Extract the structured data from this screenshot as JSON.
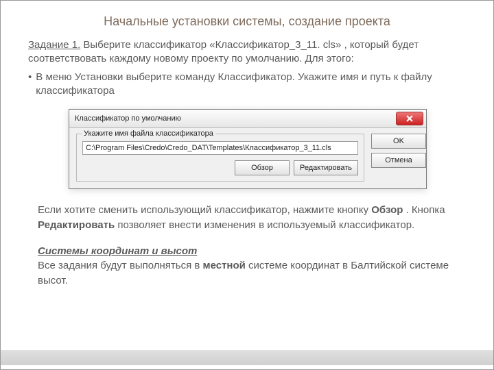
{
  "title": "Начальные установки системы, создание проекта",
  "task_label": "Задание 1.",
  "task_text": " Выберите классификатор «Классификатор_3_11. cls» , который будет соответствовать каждому новому проекту по умолчанию. Для этого:",
  "bullet_text": "В меню Установки выберите команду  Классификатор.   Укажите имя и путь к файлу  классификатора",
  "dialog": {
    "title": "Классификатор по умолчанию",
    "group_label": "Укажите имя файла классификатора",
    "path_value": "C:\\Program Files\\Credo\\Credo_DAT\\Templates\\Классификатор_3_11.cls",
    "browse": "Обзор",
    "edit": "Редактировать",
    "ok": "OK",
    "cancel": "Отмена"
  },
  "descr1_a": "Если  хотите сменить использующий классификатор, нажмите кнопку ",
  "descr1_b": "Обзор",
  "descr1_c": " .  Кнопка ",
  "descr1_d": "Редактировать",
  "descr1_e": " позволяет внести изменения в используемый классификатор.",
  "sec_title": "Системы координат и высот",
  "sec_a": "Все задания будут выполняться в ",
  "sec_b": "местной",
  "sec_c": " системе координат в Балтийской системе высот."
}
